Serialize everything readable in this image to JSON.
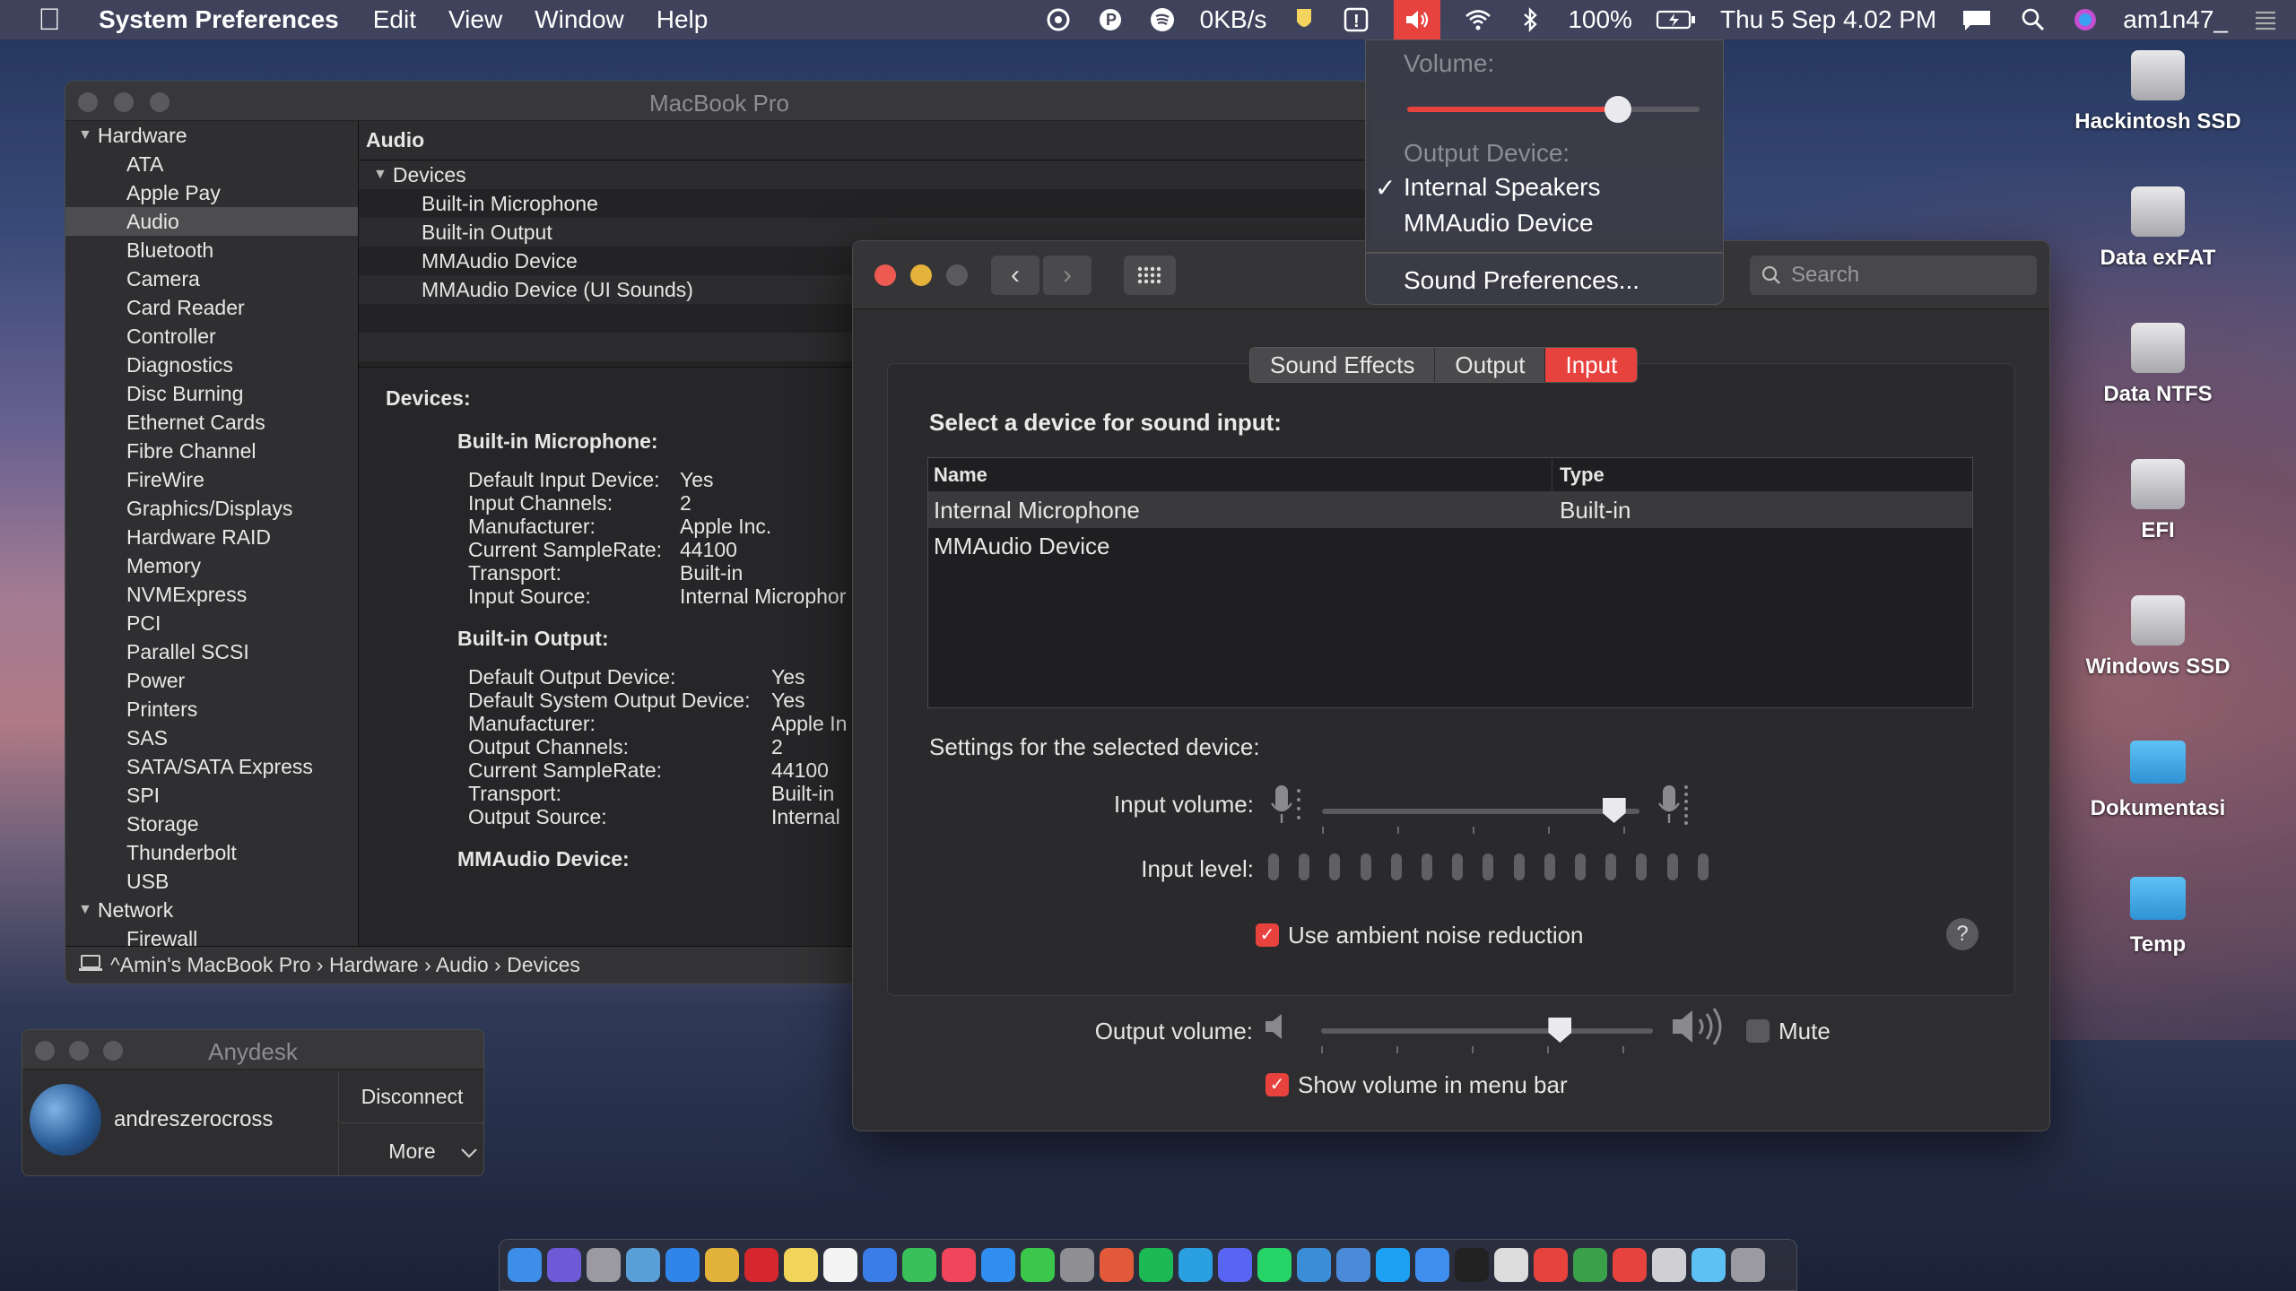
{
  "menubar": {
    "apple_icon": "apple-icon",
    "app_name": "System Preferences",
    "menus": [
      "Edit",
      "View",
      "Window",
      "Help"
    ],
    "net_speed": "0KB/s",
    "battery": "100%",
    "datetime": "Thu 5 Sep  4.02 PM",
    "user": "am1n47_"
  },
  "volume_menu": {
    "volume_label": "Volume:",
    "volume_level": 0.72,
    "output_label": "Output Device:",
    "devices": [
      "Internal Speakers",
      "MMAudio Device"
    ],
    "selected_device": "Internal Speakers",
    "sound_prefs": "Sound Preferences..."
  },
  "sysinfo": {
    "title": "MacBook Pro",
    "sidebar": {
      "hardware_group": "Hardware",
      "hardware_items": [
        "ATA",
        "Apple Pay",
        "Audio",
        "Bluetooth",
        "Camera",
        "Card Reader",
        "Controller",
        "Diagnostics",
        "Disc Burning",
        "Ethernet Cards",
        "Fibre Channel",
        "FireWire",
        "Graphics/Displays",
        "Hardware RAID",
        "Memory",
        "NVMExpress",
        "PCI",
        "Parallel SCSI",
        "Power",
        "Printers",
        "SAS",
        "SATA/SATA Express",
        "SPI",
        "Storage",
        "Thunderbolt",
        "USB"
      ],
      "selected": "Audio",
      "network_group": "Network",
      "network_items": [
        "Firewall"
      ]
    },
    "header": "Audio",
    "tree": {
      "group": "Devices",
      "items": [
        "Built-in Microphone",
        "Built-in Output",
        "MMAudio Device",
        "MMAudio Device (UI Sounds)"
      ]
    },
    "detail": {
      "devices_label": "Devices:",
      "mic_title": "Built-in Microphone:",
      "mic": [
        [
          "Default Input Device:",
          "Yes"
        ],
        [
          "Input Channels:",
          "2"
        ],
        [
          "Manufacturer:",
          "Apple Inc."
        ],
        [
          "Current SampleRate:",
          "44100"
        ],
        [
          "Transport:",
          "Built-in"
        ],
        [
          "Input Source:",
          "Internal Microphor"
        ]
      ],
      "out_title": "Built-in Output:",
      "out": [
        [
          "Default Output Device:",
          "Yes"
        ],
        [
          "Default System Output Device:",
          "Yes"
        ],
        [
          "Manufacturer:",
          "Apple In"
        ],
        [
          "Output Channels:",
          "2"
        ],
        [
          "Current SampleRate:",
          "44100"
        ],
        [
          "Transport:",
          "Built-in"
        ],
        [
          "Output Source:",
          "Internal"
        ]
      ],
      "mm_title": "MMAudio Device:"
    },
    "breadcrumb": "^Amin's MacBook Pro › Hardware › Audio › Devices"
  },
  "sound": {
    "search_placeholder": "Search",
    "tabs": [
      "Sound Effects",
      "Output",
      "Input"
    ],
    "active_tab": "Input",
    "heading": "Select a device for sound input:",
    "columns": [
      "Name",
      "Type"
    ],
    "rows": [
      [
        "Internal Microphone",
        "Built-in"
      ],
      [
        "MMAudio Device",
        ""
      ]
    ],
    "selected_row": 0,
    "settings_label": "Settings for the selected device:",
    "input_volume_label": "Input volume:",
    "input_volume": 0.92,
    "input_level_label": "Input level:",
    "input_level_segments": 15,
    "noise_reduction_label": "Use ambient noise reduction",
    "noise_reduction": true,
    "output_volume_label": "Output volume:",
    "output_volume": 0.72,
    "mute_label": "Mute",
    "mute": false,
    "show_volume_label": "Show volume in menu bar",
    "show_volume": true,
    "help_glyph": "?"
  },
  "anydesk": {
    "title": "Anydesk",
    "user": "andreszerocross",
    "disconnect": "Disconnect",
    "more": "More"
  },
  "desktop": {
    "icons": [
      {
        "label": "Hackintosh SSD",
        "kind": "drive"
      },
      {
        "label": "Data exFAT",
        "kind": "drive"
      },
      {
        "label": "Data NTFS",
        "kind": "drive"
      },
      {
        "label": "EFI",
        "kind": "drive"
      },
      {
        "label": "Windows SSD",
        "kind": "drive"
      },
      {
        "label": "Dokumentasi",
        "kind": "folder"
      },
      {
        "label": "Temp",
        "kind": "folder"
      }
    ]
  },
  "dock": {
    "apps": [
      "finder-icon",
      "siri-icon",
      "launchpad-icon",
      "preview-icon",
      "safari-icon",
      "chrome-icon",
      "opera-icon",
      "notes-icon",
      "reminders-icon",
      "messages-icon",
      "facetime-icon",
      "music-icon",
      "app-store-icon",
      "line-icon",
      "system-preferences-icon",
      "airmail-icon",
      "spotify-icon",
      "telegram-icon",
      "discord-icon",
      "whatsapp-icon",
      "tweetbot-icon",
      "screenshot-icon",
      "twitter-icon",
      "xcode-icon",
      "terminal-icon",
      "bbedit-icon",
      "anydesk-icon",
      "globe-icon",
      "anydesk2-icon",
      "script-editor-icon",
      "folder-icon",
      "trash-icon"
    ],
    "colors": [
      "#3d8ee8",
      "#6e5ad6",
      "#9a9aa0",
      "#5aa0d8",
      "#2f86e8",
      "#e3b23a",
      "#d6262e",
      "#f1d45a",
      "#f4f4f4",
      "#3a7de8",
      "#3ac05a",
      "#f0455a",
      "#2f8ef0",
      "#3ac74a",
      "#8e8e93",
      "#e25a3a",
      "#1db954",
      "#2aa0e0",
      "#5865f2",
      "#25d366",
      "#3a8ed8",
      "#4a8ad8",
      "#1da1f2",
      "#3e8ef0",
      "#222222",
      "#dcdcdc",
      "#e8423f",
      "#3aa04a",
      "#e8423f",
      "#cfcfd4",
      "#5ec1f4",
      "#9a9aa0"
    ]
  },
  "accent": "#e8423f"
}
